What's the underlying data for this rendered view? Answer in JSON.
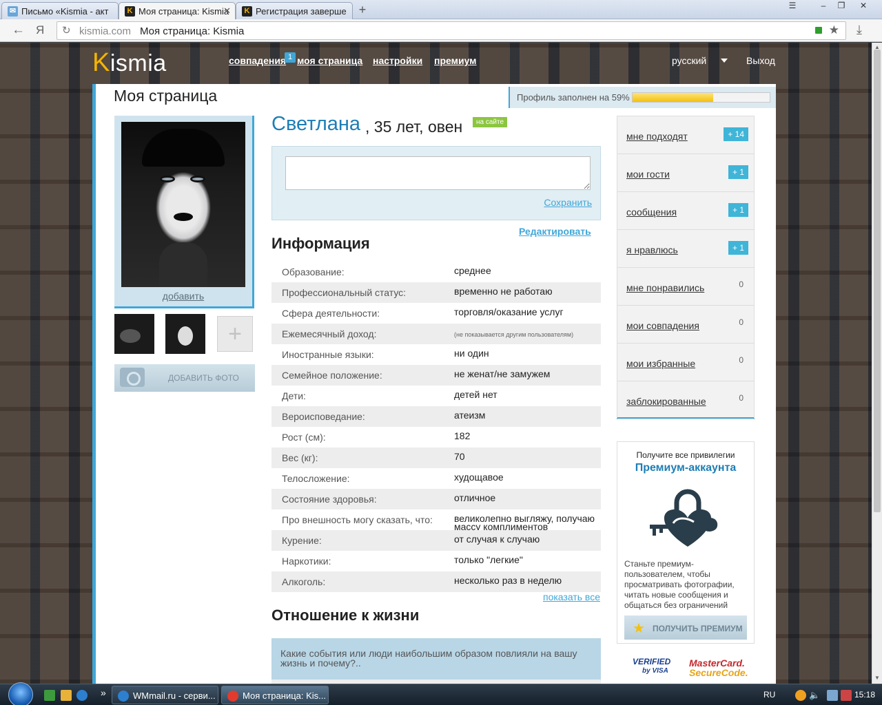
{
  "browser": {
    "tabs": [
      {
        "label": "Письмо «Kismia - акт",
        "icon": "mail-icon"
      },
      {
        "label": "Моя страница: Kismia",
        "icon": "kismia-icon"
      },
      {
        "label": "Регистрация заверше",
        "icon": "kismia-icon"
      }
    ],
    "address_domain": "kismia.com",
    "address_title": "Моя страница: Kismia",
    "ya_label": "Я"
  },
  "site": {
    "logo_first": "K",
    "logo_rest": "ismia",
    "nav": [
      {
        "label": "совпадения"
      },
      {
        "label": "моя страница"
      },
      {
        "label": "настройки"
      },
      {
        "label": "премиум"
      }
    ],
    "nav_badge": "1",
    "language": "русский",
    "logout": "Выход"
  },
  "page": {
    "title": "Моя страница",
    "profile_progress_label": "Профиль заполнен на 59%",
    "profile_progress": 0.59
  },
  "profile": {
    "name": "Светлана",
    "age_sign": ", 35 лет, овен",
    "online": "на сайте",
    "add_link": "добавить",
    "add_photo": "ДОБАВИТЬ ФОТО",
    "save": "Сохранить",
    "edit": "Редактировать"
  },
  "info": {
    "title": "Информация",
    "rows": [
      {
        "k": "Образование:",
        "v": "среднее"
      },
      {
        "k": "Профессиональный статус:",
        "v": "временно не работаю"
      },
      {
        "k": "Сфера деятельности:",
        "v": "торговля/оказание услуг"
      },
      {
        "k": "Ежемесячный доход:",
        "v": "(не показывается другим пользователям)"
      },
      {
        "k": "Иностранные языки:",
        "v": "ни один"
      },
      {
        "k": "Семейное положение:",
        "v": "не женат/не замужем"
      },
      {
        "k": "Дети:",
        "v": "детей нет"
      },
      {
        "k": "Вероисповедание:",
        "v": "атеизм"
      },
      {
        "k": "Рост (см):",
        "v": "182"
      },
      {
        "k": "Вес (кг):",
        "v": "70"
      },
      {
        "k": "Телосложение:",
        "v": "худощавое"
      },
      {
        "k": "Состояние здоровья:",
        "v": "отличное"
      },
      {
        "k": "Про внешность могу сказать, что:",
        "v": "великолепно выгляжу, получаю массу комплиментов"
      },
      {
        "k": "Курение:",
        "v": "от случая к случаю"
      },
      {
        "k": "Наркотики:",
        "v": "только \"легкие\""
      },
      {
        "k": "Алкоголь:",
        "v": "несколько раз в неделю"
      }
    ],
    "show_all": "показать все"
  },
  "life": {
    "title": "Отношение к жизни",
    "question": "Какие события или люди наибольшим образом повлияли на вашу жизнь и почему?.."
  },
  "sidebar": {
    "items": [
      {
        "label": "мне подходят",
        "count": "+ 14",
        "highlight": true
      },
      {
        "label": "мои гости",
        "count": "+ 1",
        "highlight": true
      },
      {
        "label": "сообщения",
        "count": "+ 1",
        "highlight": true
      },
      {
        "label": "я нравлюсь",
        "count": "+ 1",
        "highlight": true
      },
      {
        "label": "мне понравились",
        "count": "0",
        "highlight": false
      },
      {
        "label": "мои совпадения",
        "count": "0",
        "highlight": false
      },
      {
        "label": "мои избранные",
        "count": "0",
        "highlight": false
      },
      {
        "label": "заблокированные",
        "count": "0",
        "highlight": false
      }
    ]
  },
  "premium": {
    "line1": "Получите все привилегии",
    "line2": "Премиум-аккаунта",
    "text": "Станьте премиум-пользователем, чтобы просматривать фотографии, читать новые сообщения и общаться без ограничений",
    "button": "ПОЛУЧИТЬ ПРЕМИУМ",
    "verified_line1": "VERIFIED",
    "verified_line2": "by VISA",
    "mc_line1": "MasterCard.",
    "mc_line2": "SecureCode."
  },
  "taskbar": {
    "buttons": [
      {
        "label": "WMmail.ru - серви..."
      },
      {
        "label": "Моя страница: Kis..."
      }
    ],
    "lang": "RU",
    "time": "15:18",
    "more": "»"
  },
  "colors": {
    "accent": "#3fa7d8",
    "name": "#1d7eb6",
    "online": "#8cc63f",
    "progress": "#f3c10c"
  }
}
